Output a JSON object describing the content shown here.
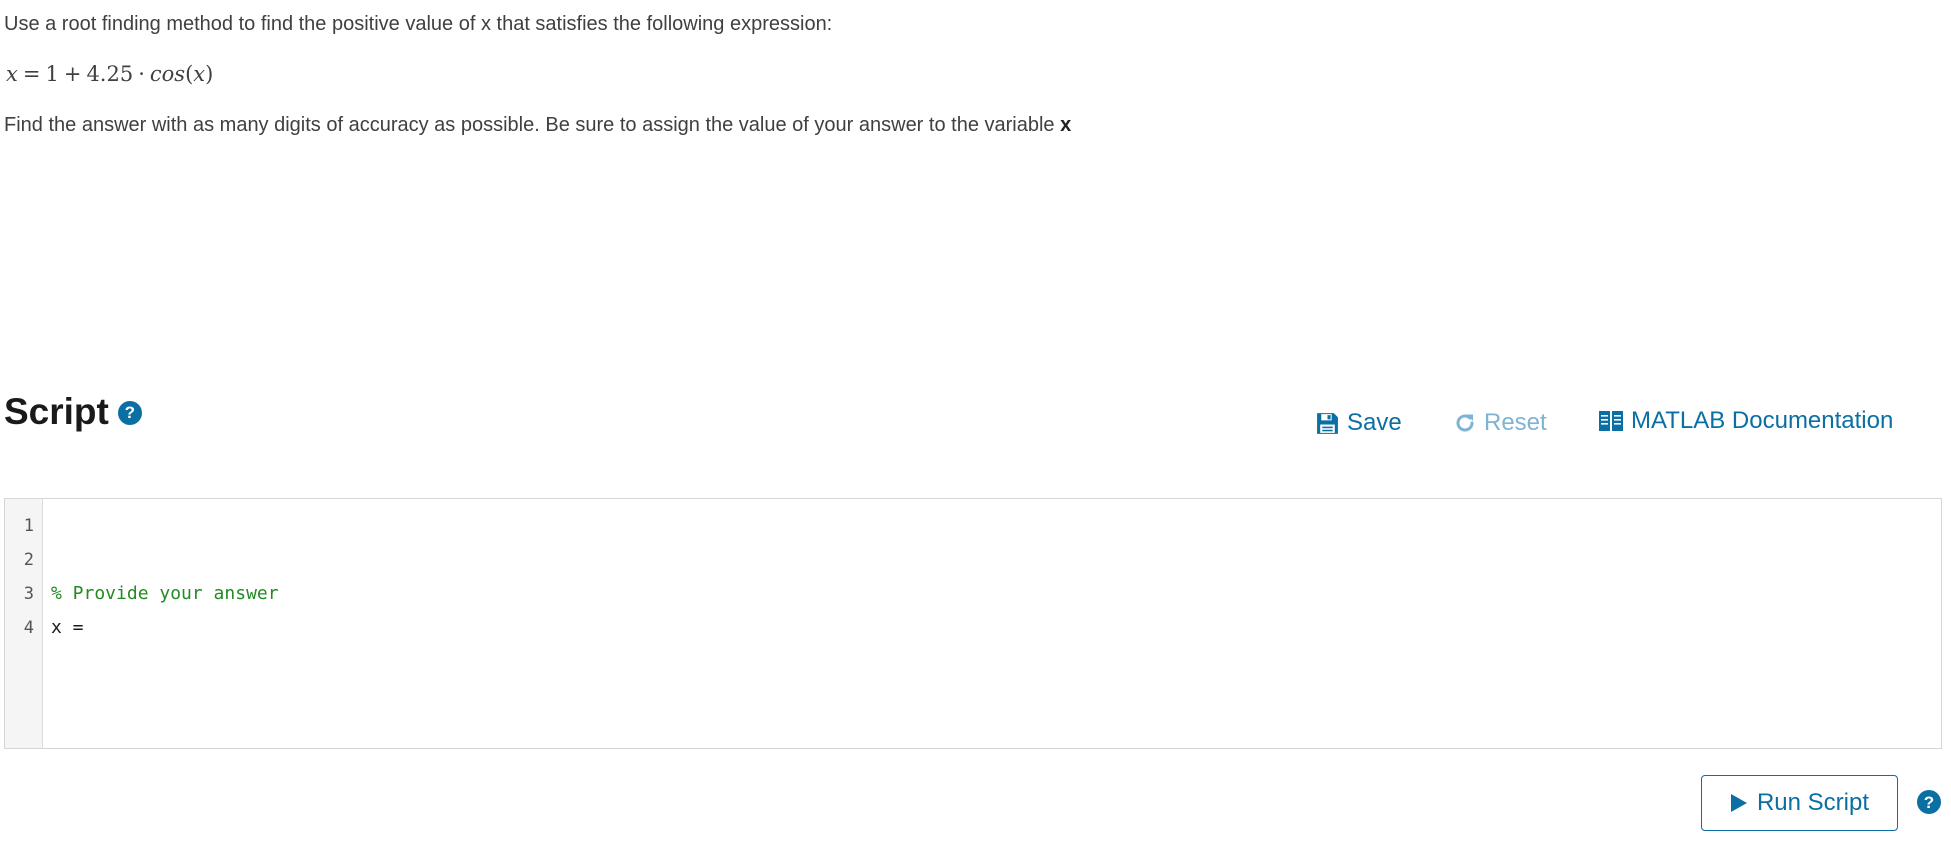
{
  "problem": {
    "intro": "Use a root finding method to find the positive value of x that satisfies the following expression:",
    "equation": {
      "lhs": "x",
      "equals": "=",
      "constant": "1",
      "plus": "+",
      "coefficient": "4.25",
      "dot": "·",
      "function": "cos",
      "open_paren": "(",
      "argument": "x",
      "close_paren": ")"
    },
    "instruction": "Find the answer with as many digits of accuracy as possible. Be sure to assign the value of your answer to the variable",
    "variable": "x"
  },
  "script": {
    "title": "Script",
    "help_icon_glyph": "?",
    "toolbar": {
      "save_label": "Save",
      "reset_label": "Reset",
      "docs_label": "MATLAB Documentation"
    },
    "editor": {
      "lines": [
        {
          "number": "1",
          "text": ""
        },
        {
          "number": "2",
          "text": ""
        },
        {
          "number": "3",
          "text": "% Provide your answer"
        },
        {
          "number": "4",
          "text": "x = "
        }
      ]
    },
    "run_label": "Run Script",
    "run_help_glyph": "?"
  },
  "colors": {
    "accent": "#0b6fa4",
    "disabled": "#7fb3d3",
    "comment": "#228b22",
    "text": "#404040"
  },
  "icons": {
    "save": "floppy-disk-icon",
    "reset": "refresh-icon",
    "docs": "book-icon",
    "run": "play-icon",
    "help": "question-circle-icon"
  }
}
